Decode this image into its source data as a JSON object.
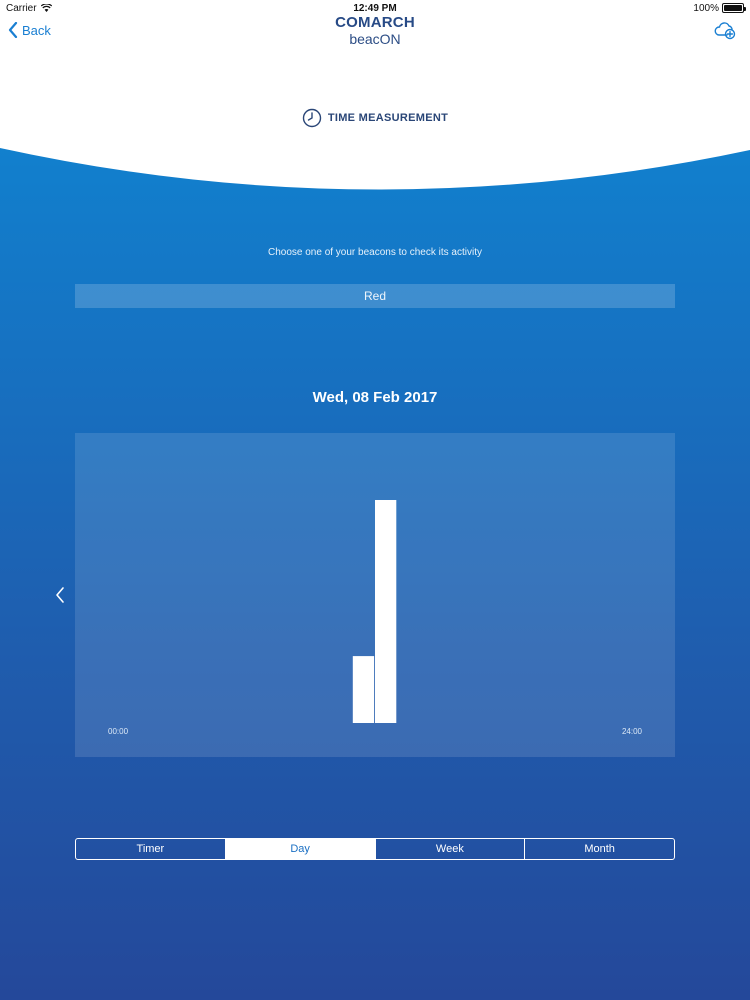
{
  "status_bar": {
    "carrier": "Carrier",
    "time": "12:49 PM",
    "battery": "100%"
  },
  "nav": {
    "back_label": "Back"
  },
  "brand": {
    "name_top": "COMARCH",
    "name_bottom": "beacON"
  },
  "section": {
    "title": "TIME MEASUREMENT",
    "icon": "clock-icon"
  },
  "main": {
    "subtitle": "Choose one of your beacons to check its activity",
    "selected_beacon": "Red",
    "date": "Wed, 08 Feb 2017"
  },
  "chart_data": {
    "type": "bar",
    "x_range": [
      0,
      24
    ],
    "x_tick_labels": [
      "00:00",
      "24:00"
    ],
    "bars": [
      {
        "hour": 11,
        "value": 0.3
      },
      {
        "hour": 12,
        "value": 1.0
      }
    ],
    "y_range": [
      0,
      1
    ],
    "grid": false,
    "bar_color": "#ffffff"
  },
  "tabs": [
    {
      "label": "Timer",
      "active": false
    },
    {
      "label": "Day",
      "active": true
    },
    {
      "label": "Week",
      "active": false
    },
    {
      "label": "Month",
      "active": false
    }
  ],
  "colors": {
    "accent": "#1a7fd2",
    "brand": "#274a86"
  }
}
